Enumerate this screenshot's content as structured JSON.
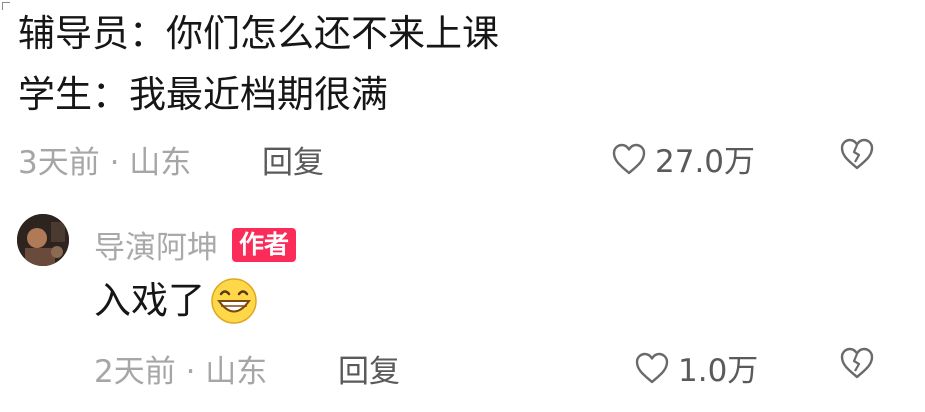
{
  "comment": {
    "lines": [
      "辅导员：你们怎么还不来上课",
      "学生：我最近档期很满"
    ],
    "time_location": "3天前 · 山东",
    "reply_label": "回复",
    "likes": "27.0万",
    "icons": {
      "like": "heart-outline-icon",
      "dislike": "broken-heart-icon"
    }
  },
  "reply": {
    "author": "导演阿坤",
    "badge": "作者",
    "text": "入戏了",
    "emoji": "grinning-face-icon",
    "time_location": "2天前 · 山东",
    "reply_label": "回复",
    "likes": "1.0万"
  },
  "colors": {
    "badge": "#fb2c5a",
    "meta": "#a6a6a6",
    "text": "#161616"
  }
}
